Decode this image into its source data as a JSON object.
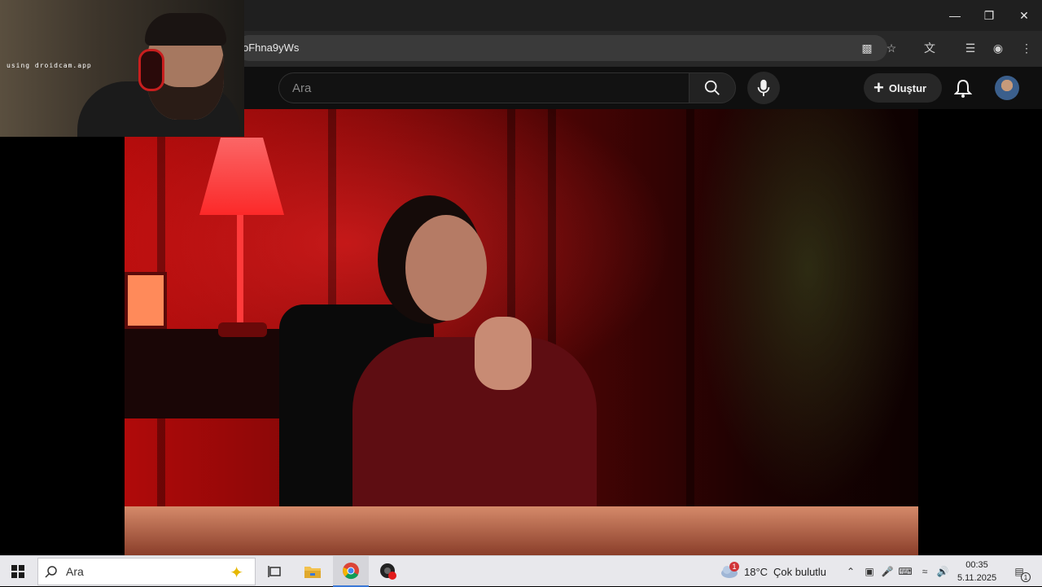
{
  "browser": {
    "url_fragment": "oFhna9yWs"
  },
  "youtube": {
    "search_placeholder": "Ara",
    "create_label": "Oluştur"
  },
  "webcam": {
    "watermark": "using droidcam.app"
  },
  "taskbar": {
    "search_placeholder": "Ara",
    "weather_temp": "18°C",
    "weather_desc": "Çok bulutlu",
    "weather_badge": "1",
    "time": "00:35",
    "date": "5.11.2025",
    "notification_count": "1"
  },
  "colors": {
    "accent": "#3a78d6",
    "yt_bg": "#0f0f0f"
  }
}
